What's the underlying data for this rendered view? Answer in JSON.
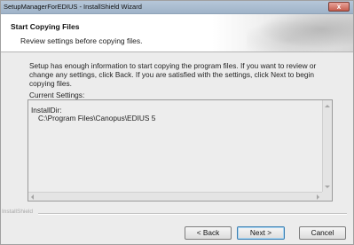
{
  "window": {
    "title": "SetupManagerForEDIUS - InstallShield Wizard",
    "close_glyph": "x"
  },
  "header": {
    "title": "Start Copying Files",
    "subtitle": "Review settings before copying files."
  },
  "body": {
    "description": "Setup has enough information to start copying the program files.  If you want to review or change any settings, click Back.  If you are satisfied with the settings, click Next to begin copying files.",
    "current_settings_label": "Current Settings:",
    "settings": {
      "line1": "InstallDir:",
      "line2": "C:\\Program Files\\Canopus\\EDIUS 5"
    }
  },
  "footer": {
    "brand": "InstallShield",
    "back_label": "< Back",
    "next_label": "Next >",
    "cancel_label": "Cancel"
  },
  "icons": {
    "close": "close-icon",
    "scroll_up": "scroll-up-arrow-icon",
    "scroll_down": "scroll-down-arrow-icon",
    "scroll_left": "scroll-left-arrow-icon",
    "scroll_right": "scroll-right-arrow-icon"
  },
  "colors": {
    "titlebar": "#a9bccf",
    "close_button": "#c75e4f",
    "default_button_border": "#3c7fb1"
  }
}
